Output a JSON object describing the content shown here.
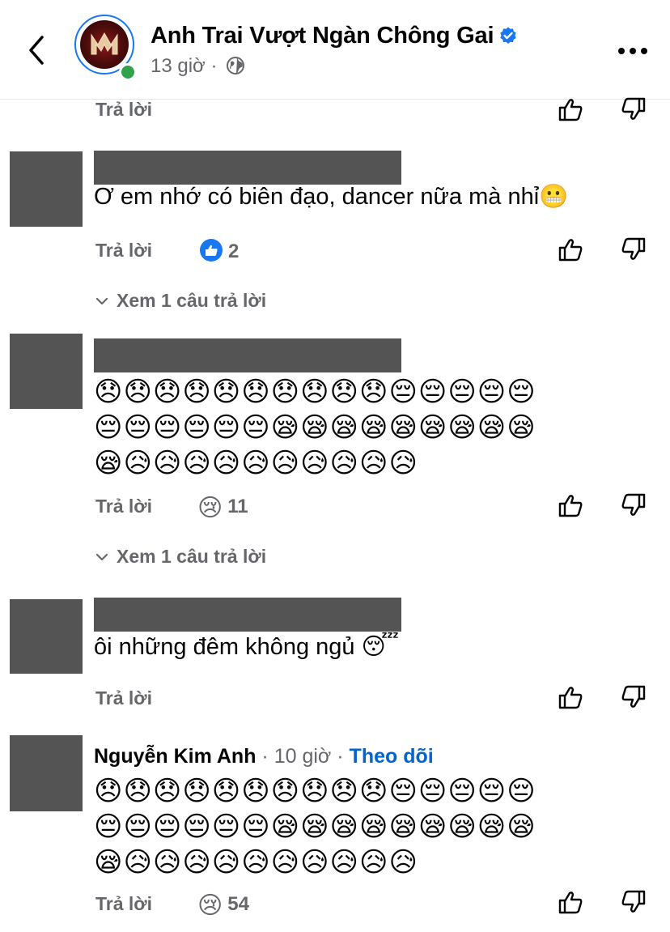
{
  "header": {
    "page_name": "Anh Trai Vượt Ngàn Chông Gai",
    "time": "13 giờ",
    "separator": "·"
  },
  "actions": {
    "reply": "Trả lời"
  },
  "comments": [
    {
      "text": "Ơ em nhớ có biên đạo, dancer nữa mà nhỉ😬",
      "reaction_count": "2",
      "reaction_icon": "like-icon",
      "view_replies": "Xem 1 câu trả lời"
    },
    {
      "emoji_lines": [
        "😞😞😞😞😞😞😞😞😞😞😔😔😔😔😔",
        "😔😔😔😔😔😔😪😪😪😪😪😪😪😪😪",
        "😪😥😥😥😥😥😥😥😥😥😥"
      ],
      "reaction_count": "11",
      "reaction_icon": "sad-icon",
      "view_replies": "Xem 1 câu trả lời"
    },
    {
      "text": "ôi những đêm không ngủ 😴"
    },
    {
      "author": "Nguyễn Kim Anh",
      "time": "10 giờ",
      "dot": "·",
      "follow": "Theo dõi",
      "emoji_lines": [
        "😞😞😞😞😞😞😞😞😞😞😔😔😔😔😔",
        "😔😔😔😔😔😔😪😪😪😪😪😪😪😪😪",
        "😪😥😥😥😥😥😥😥😥😥😥"
      ],
      "reaction_count": "54",
      "reaction_icon": "sad-icon"
    }
  ],
  "colors": {
    "accent": "#1877f2",
    "muted": "#65676b",
    "follow": "#0064d1",
    "redacted": "#545454",
    "online": "#31a24c"
  }
}
